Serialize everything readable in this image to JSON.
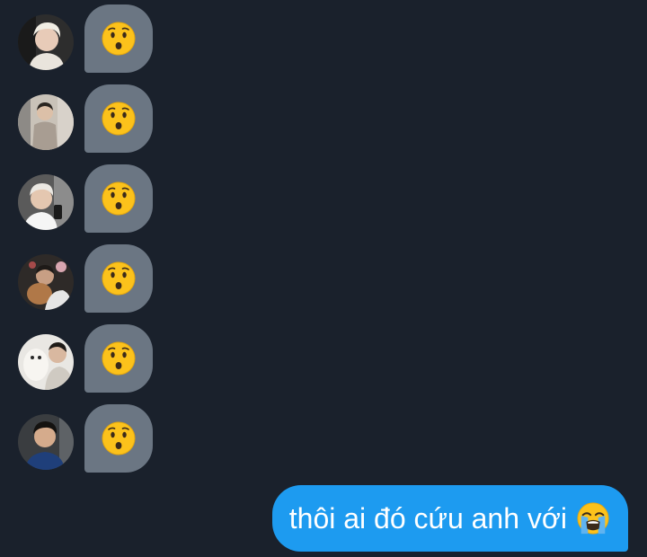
{
  "colors": {
    "background": "#1a212c",
    "incoming_bubble": "#6b7683",
    "outgoing_bubble": "#1d9bf0",
    "text_on_outgoing": "#ffffff"
  },
  "messages_incoming": [
    {
      "avatar_icon": "user-avatar",
      "emoji": "hushed-face-emoji"
    },
    {
      "avatar_icon": "user-avatar",
      "emoji": "hushed-face-emoji"
    },
    {
      "avatar_icon": "user-avatar",
      "emoji": "hushed-face-emoji"
    },
    {
      "avatar_icon": "user-avatar",
      "emoji": "hushed-face-emoji"
    },
    {
      "avatar_icon": "user-avatar",
      "emoji": "hushed-face-emoji"
    },
    {
      "avatar_icon": "user-avatar",
      "emoji": "hushed-face-emoji"
    }
  ],
  "message_outgoing": {
    "text": "thôi ai đó cứu anh với",
    "emoji": "loudly-crying-face-emoji"
  }
}
